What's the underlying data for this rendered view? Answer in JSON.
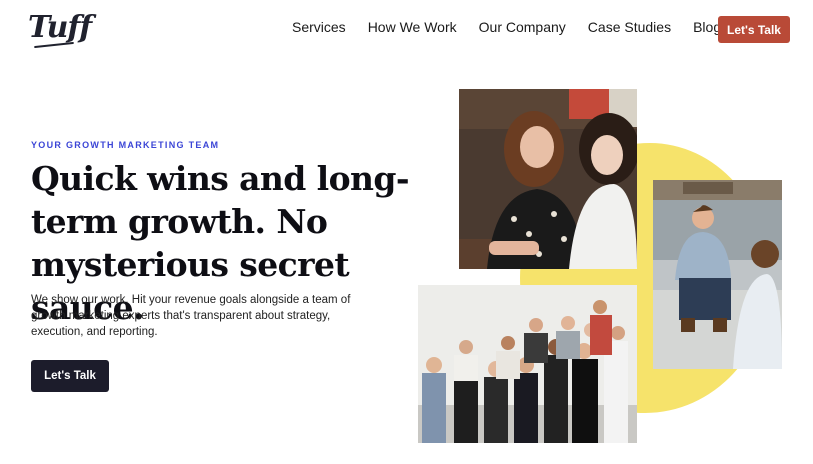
{
  "brand": {
    "logo_text": "Tuff"
  },
  "nav": {
    "items": [
      {
        "label": "Services"
      },
      {
        "label": "How We Work"
      },
      {
        "label": "Our Company"
      },
      {
        "label": "Case Studies"
      },
      {
        "label": "Blog"
      }
    ],
    "cta_label": "Let's Talk"
  },
  "hero": {
    "eyebrow": "YOUR GROWTH MARKETING TEAM",
    "headline": "Quick wins and long-term growth. No mysterious secret sauce.",
    "subcopy": "We show our work. Hit your revenue goals alongside a team of growth marketing experts that's transparent about strategy, execution, and reporting.",
    "cta_label": "Let's Talk"
  },
  "colors": {
    "accent_red": "#b94a37",
    "accent_blue": "#3b45d6",
    "dark_button": "#1c1c2b",
    "yellow_shape": "#f6e36b"
  }
}
